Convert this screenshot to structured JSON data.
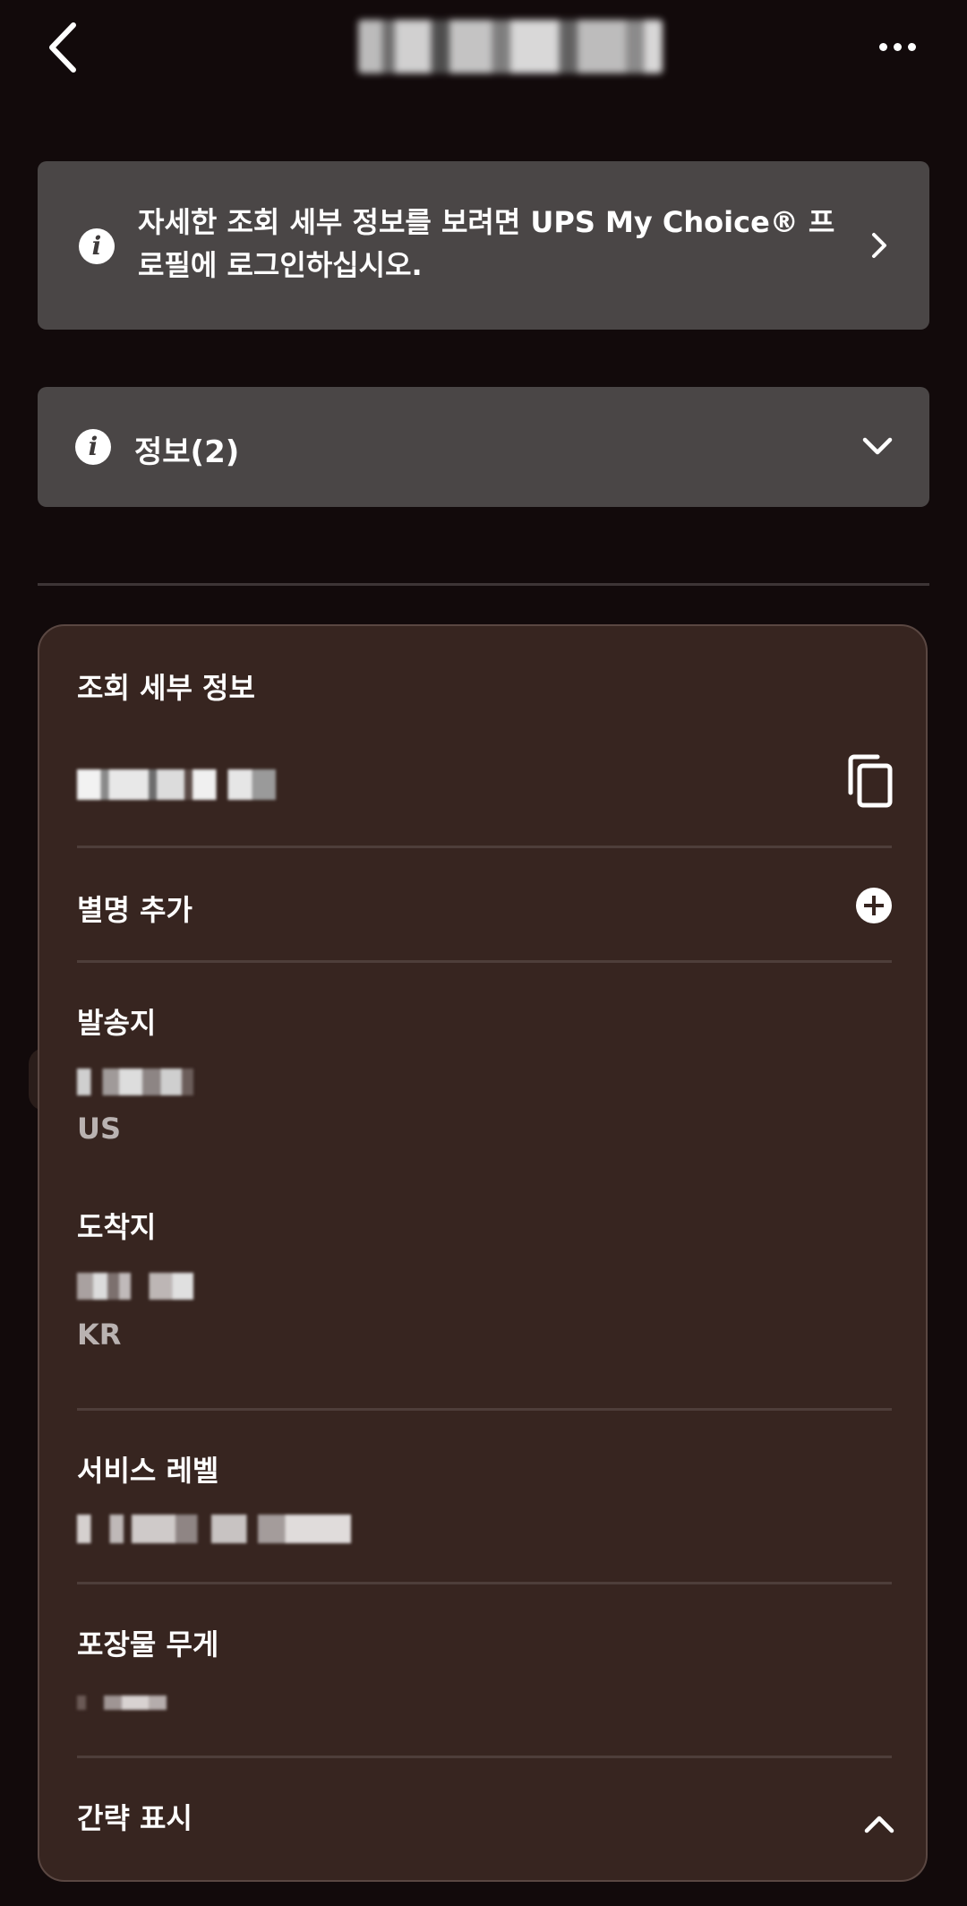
{
  "header": {
    "back_icon": "back-arrow-icon",
    "more_icon": "more-horizontal-icon"
  },
  "banner": {
    "icon": "info-icon",
    "text": "자세한 조회 세부 정보를 보려면 UPS My Choice® 프로필에 로그인하십시오.",
    "chevron": "chevron-right-icon"
  },
  "info_bar": {
    "icon": "info-icon",
    "label": "정보(2)",
    "chevron": "chevron-down-icon"
  },
  "details": {
    "title": "조회 세부 정보",
    "copy_icon": "copy-icon",
    "add_nickname_label": "별명 추가",
    "add_icon": "plus-circle-icon",
    "origin": {
      "label": "발송지",
      "country": "US"
    },
    "destination": {
      "label": "도착지",
      "country": "KR"
    },
    "service_level_label": "서비스 레벨",
    "package_weight_label": "포장물 무게",
    "collapse_label": "간략 표시",
    "collapse_icon": "chevron-up-icon"
  },
  "colors": {
    "background": "#120a0b",
    "banner_bg": "#4a4646",
    "card_bg": "#372520",
    "text": "#ffffff",
    "muted_text": "#b9b2b1"
  }
}
